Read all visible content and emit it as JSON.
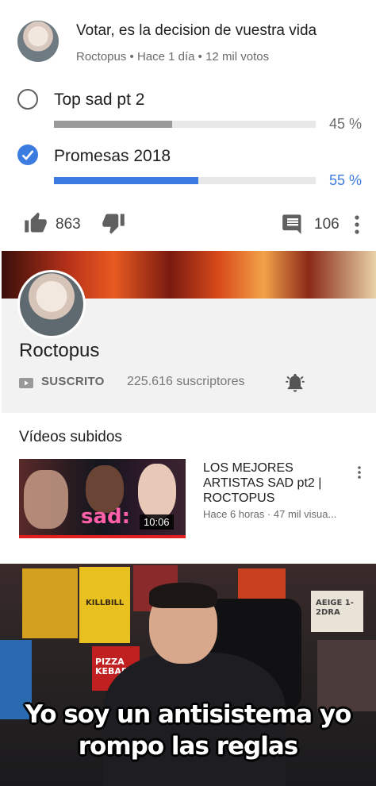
{
  "poll": {
    "title": "Votar, es la decision de vuestra vida",
    "meta": "Roctopus • Hace 1 día • 12 mil votos",
    "options": [
      {
        "label": "Top sad pt 2",
        "percent_text": "45 %",
        "percent": 45,
        "selected": false
      },
      {
        "label": "Promesas 2018",
        "percent_text": "55 %",
        "percent": 55,
        "selected": true
      }
    ],
    "likes": "863",
    "comments": "106",
    "accent_color": "#3c7be0"
  },
  "channel": {
    "name": "Roctopus",
    "subscribe_label": "SUSCRITO",
    "subscribers": "225.616 suscriptores",
    "uploads_heading": "Vídeos subidos",
    "video": {
      "title": "LOS MEJORES ARTISTAS SAD pt2 | ROCTOPUS",
      "meta": "Hace 6 horas · 47 mil visua...",
      "duration": "10:06",
      "thumbnail_text": "sad:"
    }
  },
  "meme": {
    "caption_line1": "Yo soy un antisistema yo",
    "caption_line2": "rompo las reglas",
    "poster_kill_bill": "KILLBILL",
    "poster_pizza": "PIZZA KEBAB",
    "poster_sign": "AEIGE 1-2DRA"
  }
}
